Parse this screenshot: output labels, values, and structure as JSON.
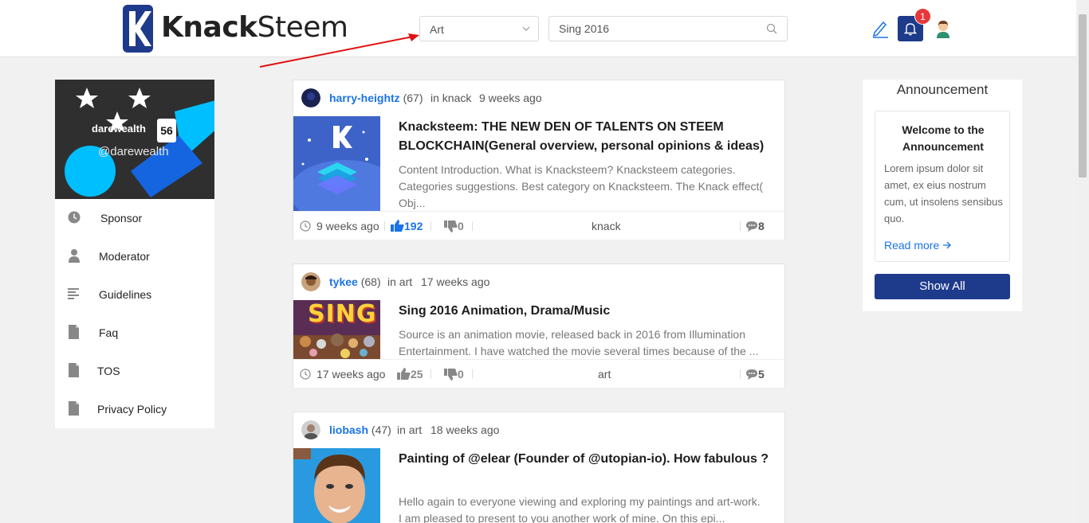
{
  "header": {
    "logo_text_part1": "Knack",
    "logo_text_part2": "Steem",
    "category_value": "Art",
    "search_value": "Sing 2016",
    "notification_count": "1"
  },
  "profile": {
    "name": "darewealth",
    "reputation": "56",
    "handle": "@darewealth"
  },
  "sidebar": {
    "items": [
      {
        "label": "Sponsor",
        "icon": "clock-icon"
      },
      {
        "label": "Moderator",
        "icon": "user-icon"
      },
      {
        "label": "Guidelines",
        "icon": "list-icon"
      },
      {
        "label": "Faq",
        "icon": "document-icon"
      },
      {
        "label": "TOS",
        "icon": "document-icon"
      },
      {
        "label": "Privacy Policy",
        "icon": "document-icon"
      }
    ]
  },
  "posts": [
    {
      "author": "harry-heightz",
      "rep": "(67)",
      "community": "in knack",
      "time": "9 weeks ago",
      "title": "Knacksteem: THE NEW DEN OF TALENTS ON STEEM BLOCKCHAIN(General overview, personal opinions & ideas)",
      "excerpt": "Content Introduction. What is Knacksteem? Knacksteem categories. Categories suggestions. Best category on Knacksteem. The Knack effect( Obj...",
      "footer_time": "9 weeks ago",
      "upvotes": "192",
      "downvotes": "0",
      "tag": "knack",
      "comments": "8"
    },
    {
      "author": "tykee",
      "rep": "(68)",
      "community": "in art",
      "time": "17 weeks ago",
      "title": "Sing 2016 Animation, Drama/Music",
      "excerpt": "Source is an animation movie, released back in 2016 from Illumination Entertainment. I have watched the movie several times because of the ...",
      "footer_time": "17 weeks ago",
      "upvotes": "25",
      "downvotes": "0",
      "tag": "art",
      "comments": "5",
      "thumb_text": "SING"
    },
    {
      "author": "liobash",
      "rep": "(47)",
      "community": "in art",
      "time": "18 weeks ago",
      "title": "Painting of @elear (Founder of @utopian-io). How fabulous ?",
      "excerpt": " Hello again to everyone viewing and exploring my paintings and art-work. I am pleased to present to you another work of mine. On this epi..."
    }
  ],
  "announcement": {
    "panel_title": "Announcement",
    "card_title": "Welcome to the Announcement",
    "body": "Lorem ipsum dolor sit amet, ex eius nostrum cum, ut insolens sensibus quo.",
    "link": "Read more",
    "button": "Show All"
  },
  "colors": {
    "accent": "#1e3a8a",
    "link": "#1a73e8",
    "badge": "#e5383b"
  }
}
